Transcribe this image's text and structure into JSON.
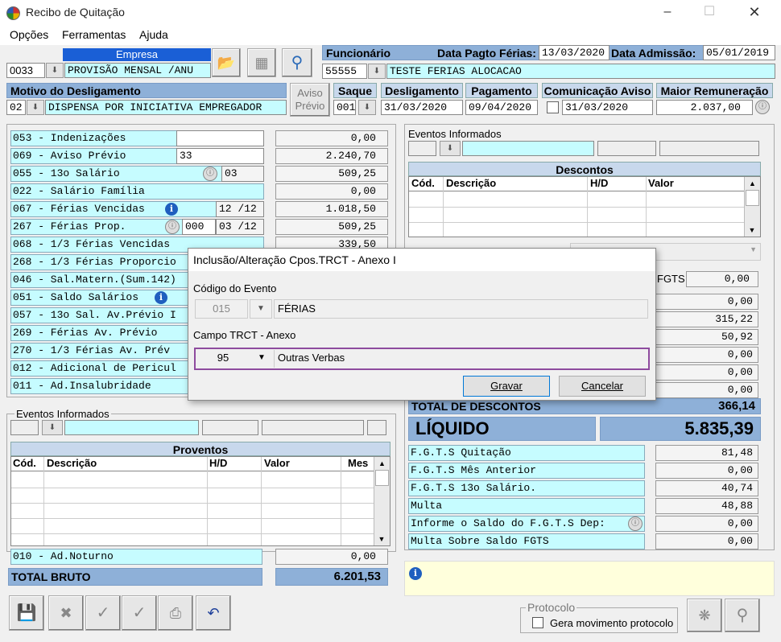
{
  "window": {
    "title": "Recibo de Quitação"
  },
  "menu": [
    "Opções",
    "Ferramentas",
    "Ajuda"
  ],
  "empresa": {
    "label": "Empresa",
    "code": "0033",
    "name": "PROVISÃO MENSAL /ANU"
  },
  "funcionario": {
    "label": "Funcionário",
    "code": "55555",
    "name": "TESTE FERIAS ALOCACAO",
    "pagto_label": "Data Pagto Férias:",
    "pagto": "13/03/2020",
    "admissao_label": "Data Admissão:",
    "admissao": "05/01/2019"
  },
  "motivo": {
    "label": "Motivo do Desligamento",
    "code": "02",
    "text": "DISPENSA POR INICIATIVA EMPREGADOR",
    "aviso_previo_btn": [
      "Aviso",
      "Prévio"
    ]
  },
  "saque": {
    "label": "Saque",
    "value": "001"
  },
  "desligamento": {
    "label": "Desligamento",
    "value": "31/03/2020"
  },
  "pagamento": {
    "label": "Pagamento",
    "value": "09/04/2020"
  },
  "comunicacao": {
    "label": "Comunicação Aviso",
    "value": "31/03/2020"
  },
  "maior_rem": {
    "label": "Maior Remuneração",
    "value": "2.037,00"
  },
  "proventos": [
    {
      "label": "053 - Indenizações",
      "value": "0,00"
    },
    {
      "label": "069 - Aviso Prévio",
      "extra": "33",
      "value": "2.240,70"
    },
    {
      "label": "055 - 13o Salário",
      "extra": "03",
      "value": "509,25"
    },
    {
      "label": "022 - Salário Família",
      "value": "0,00"
    },
    {
      "label": "067 - Férias Vencidas",
      "extra": "12 /12",
      "value": "1.018,50"
    },
    {
      "label": "267 - Férias Prop.",
      "extra0": "000",
      "extra": "03 /12",
      "value": "509,25"
    },
    {
      "label": "068 - 1/3 Férias Vencidas",
      "value": "339,50"
    },
    {
      "label": "268 - 1/3 Férias Proporcio",
      "value": ""
    },
    {
      "label": "046 - Sal.Matern.(Sum.142)",
      "value": ""
    },
    {
      "label": "051 - Saldo Salários",
      "value": ""
    },
    {
      "label": "057 - 13o Sal. Av.Prévio I",
      "value": ""
    },
    {
      "label": "269 - Férias Av. Prévio",
      "value": ""
    },
    {
      "label": "270 - 1/3 Férias Av. Prév",
      "value": ""
    },
    {
      "label": "012 - Adicional de Pericul",
      "value": ""
    },
    {
      "label": "011 - Ad.Insalubridade",
      "value": ""
    }
  ],
  "eventos_informados": "Eventos Informados",
  "proventos_table": {
    "title": "Proventos",
    "cols": [
      "Cód.",
      "Descrição",
      "H/D",
      "Valor",
      "Mes"
    ]
  },
  "noturno": {
    "label": "010 - Ad.Noturno",
    "value": "0,00"
  },
  "total_bruto": {
    "label": "TOTAL BRUTO",
    "value": "6.201,53"
  },
  "descontos_table": {
    "title": "Descontos",
    "cols": [
      "Cód.",
      "Descrição",
      "H/D",
      "Valor"
    ]
  },
  "fgts_right": {
    "label": "FGTS",
    "value": "0,00"
  },
  "desc_values": [
    "0,00",
    "315,22",
    "50,92",
    "0,00",
    "0,00",
    "0,00"
  ],
  "total_descontos": {
    "label": "TOTAL DE DESCONTOS",
    "value": "366,14"
  },
  "liquido": {
    "label": "LÍQUIDO",
    "value": "5.835,39"
  },
  "fgts_rows": [
    {
      "label": "F.G.T.S Quitação",
      "value": "81,48"
    },
    {
      "label": "F.G.T.S Mês Anterior",
      "value": "0,00"
    },
    {
      "label": "F.G.T.S 13o Salário.",
      "value": "40,74"
    },
    {
      "label": "Multa",
      "value": "48,88"
    },
    {
      "label": "Informe o Saldo do F.G.T.S Dep:",
      "value": "0,00"
    },
    {
      "label": "Multa Sobre Saldo FGTS",
      "value": "0,00"
    }
  ],
  "protocolo": {
    "title": "Protocolo",
    "checkbox": "Gera movimento protocolo"
  },
  "dialog": {
    "title": "Inclusão/Alteração Cpos.TRCT - Anexo I",
    "codigo_label": "Código do Evento",
    "codigo": "015",
    "codigo_desc": "FÉRIAS",
    "campo_label": "Campo TRCT - Anexo",
    "campo": "95",
    "campo_desc": "Outras Verbas",
    "gravar": "Gravar",
    "cancelar": "Cancelar"
  }
}
